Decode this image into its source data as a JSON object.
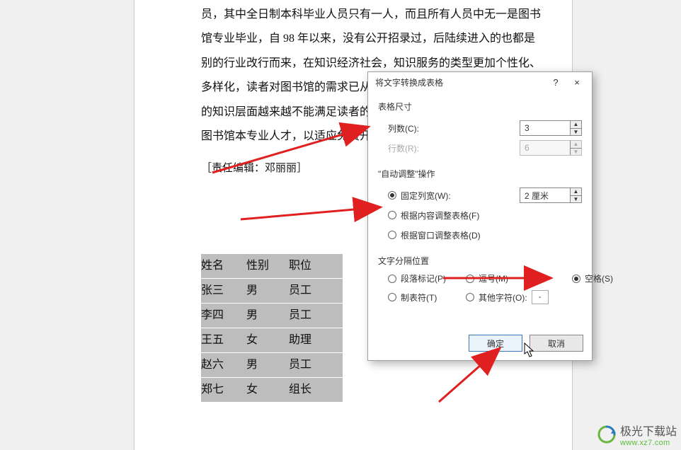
{
  "document": {
    "paragraph1": "员，其中全日制本科毕业人员只有一人，而且所有人员中无一是图书",
    "paragraph2": "馆专业毕业，自 98 年以来，没有公开招录过，后陆续进入的也都是",
    "paragraph3": "别的行业改行而来，在知识经济社会，知识服务的类型更加个性化、",
    "paragraph4": "多样化，读者对图书馆的需求已从按",
    "paragraph5": "的知识层面越来越不能满足读者的要",
    "paragraph6": "图书馆本专业人才，以适应免费开放",
    "editor_note": "［责任编辑：邓丽丽］",
    "table": {
      "header": [
        "姓名",
        "性别",
        "职位"
      ],
      "rows": [
        [
          "张三",
          "男",
          "员工"
        ],
        [
          "李四",
          "男",
          "员工"
        ],
        [
          "王五",
          "女",
          "助理"
        ],
        [
          "赵六",
          "男",
          "员工"
        ],
        [
          "郑七",
          "女",
          "组长"
        ]
      ]
    }
  },
  "dialog": {
    "title": "将文字转换成表格",
    "help": "?",
    "close": "×",
    "table_size_label": "表格尺寸",
    "columns_label": "列数(C):",
    "columns_value": "3",
    "rows_label": "行数(R):",
    "rows_value": "6",
    "autofit_group": "\"自动调整\"操作",
    "fixed_width_label": "固定列宽(W):",
    "fixed_width_value": "2 厘米",
    "autofit_content_label": "根据内容调整表格(F)",
    "autofit_window_label": "根据窗口调整表格(D)",
    "separator_group": "文字分隔位置",
    "sep_paragraph": "段落标记(P)",
    "sep_comma": "逗号(M)",
    "sep_space": "空格(S)",
    "sep_tab": "制表符(T)",
    "sep_other": "其他字符(O):",
    "sep_other_char": "-",
    "ok_label": "确定",
    "cancel_label": "取消"
  },
  "watermark": {
    "text": "极光下载站",
    "url": "www.xz7.com"
  }
}
